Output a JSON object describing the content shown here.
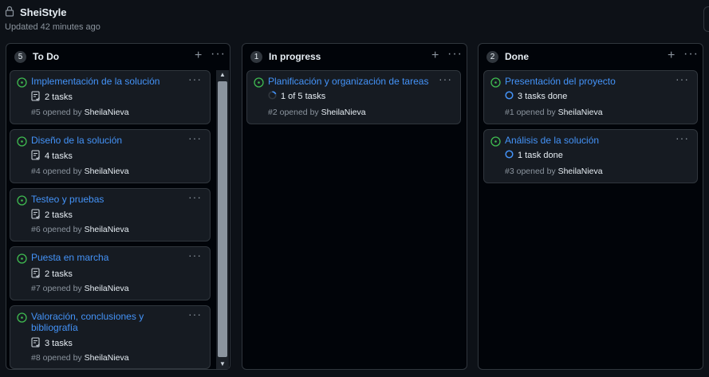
{
  "project": {
    "title": "SheiStyle",
    "updated": "Updated 42 minutes ago",
    "lock_icon": "lock-icon"
  },
  "colors": {
    "background": "#0d1117",
    "column_bg": "#010409",
    "card_bg": "#161b22",
    "border": "#30363d",
    "link": "#4493f8",
    "open_green": "#3fb950",
    "muted": "#8b949e"
  },
  "columns": [
    {
      "name": "To Do",
      "count": "5",
      "add": "+",
      "menu": "···",
      "cards": [
        {
          "title": "Implementación de la solución",
          "tasks": "2 tasks",
          "number": "#5",
          "opened": "opened by",
          "author": "SheilaNieva",
          "menu": "···"
        },
        {
          "title": "Diseño de la solución",
          "tasks": "4 tasks",
          "number": "#4",
          "opened": "opened by",
          "author": "SheilaNieva",
          "menu": "···"
        },
        {
          "title": "Testeo y pruebas",
          "tasks": "2 tasks",
          "number": "#6",
          "opened": "opened by",
          "author": "SheilaNieva",
          "menu": "···"
        },
        {
          "title": "Puesta en marcha",
          "tasks": "2 tasks",
          "number": "#7",
          "opened": "opened by",
          "author": "SheilaNieva",
          "menu": "···"
        },
        {
          "title": "Valoración, conclusiones y bibliografía",
          "tasks": "3 tasks",
          "number": "#8",
          "opened": "opened by",
          "author": "SheilaNieva",
          "menu": "···"
        }
      ]
    },
    {
      "name": "In progress",
      "count": "1",
      "add": "+",
      "menu": "···",
      "cards": [
        {
          "title": "Planificación y organización de tareas",
          "tasks": "1 of 5 tasks",
          "progress": 0.2,
          "number": "#2",
          "opened": "opened by",
          "author": "SheilaNieva",
          "menu": "···"
        }
      ]
    },
    {
      "name": "Done",
      "count": "2",
      "add": "+",
      "menu": "···",
      "cards": [
        {
          "title": "Presentación del proyecto",
          "tasks": "3 tasks done",
          "number": "#1",
          "opened": "opened by",
          "author": "SheilaNieva",
          "menu": "···"
        },
        {
          "title": "Análisis de la solución",
          "tasks": "1 task done",
          "number": "#3",
          "opened": "opened by",
          "author": "SheilaNieva",
          "menu": "···"
        }
      ]
    }
  ],
  "scrollbar": {
    "up": "▲",
    "down": "▼"
  }
}
